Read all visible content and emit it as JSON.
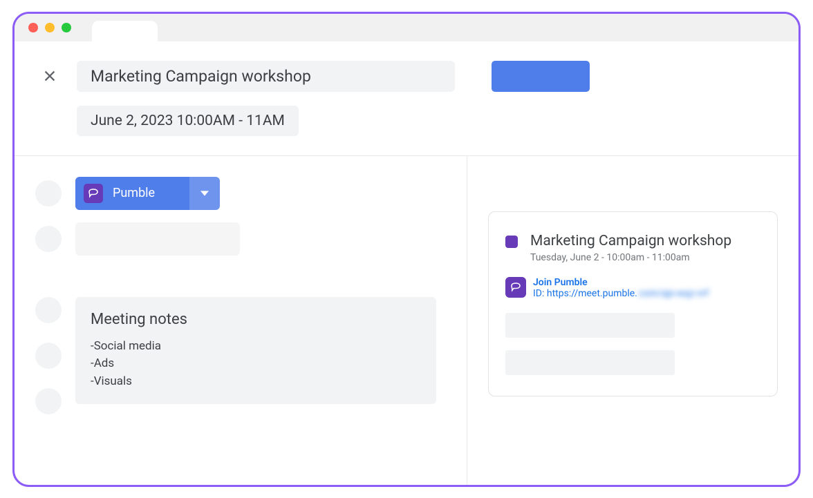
{
  "event": {
    "title": "Marketing Campaign workshop",
    "datetime": "June 2, 2023 10:00AM - 11AM"
  },
  "conference": {
    "provider": "Pumble"
  },
  "notes": {
    "heading": "Meeting notes",
    "items": [
      "-Social media",
      "-Ads",
      "-Visuals"
    ]
  },
  "card": {
    "title": "Marketing Campaign workshop",
    "datetime": "Tuesday, June 2 - 10:00am - 11:00am",
    "joinLabel": "Join Pumble",
    "meetIdPrefix": "ID: https://meet.pumble.",
    "meetIdBlurred": "com/ajx-wqz-vrf"
  }
}
